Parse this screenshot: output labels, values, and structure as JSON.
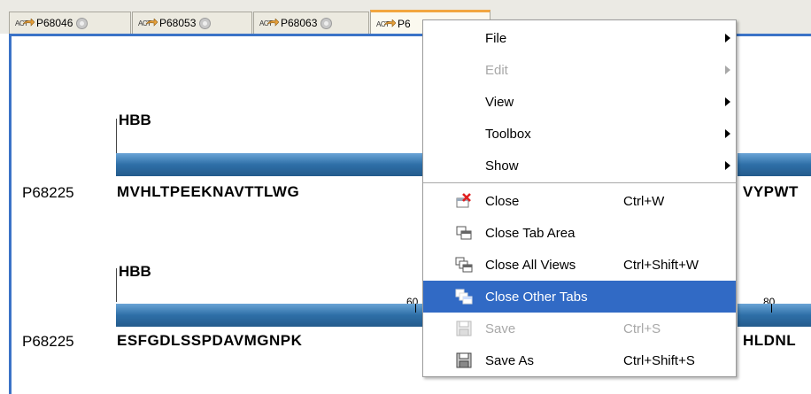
{
  "tabs": [
    {
      "label": "P68046",
      "badge": "ACT"
    },
    {
      "label": "P68053",
      "badge": "ACT"
    },
    {
      "label": "P68063",
      "badge": "ACT"
    },
    {
      "label": "P6",
      "badge": "ACT"
    }
  ],
  "rows": [
    {
      "gene": "HBB",
      "id": "P68225",
      "seq_left": "MVHLTPEEKNAVTTLWG",
      "seq_right": "VYPWT"
    },
    {
      "gene": "HBB",
      "id": "P68225",
      "seq_left": "ESFGDLSSPDAVMGNPK",
      "seq_right": "HLDNL",
      "ruler": [
        "60",
        "80"
      ]
    }
  ],
  "context_menu": {
    "items": [
      {
        "label": "File",
        "submenu": true
      },
      {
        "label": "Edit",
        "submenu": true,
        "disabled": true
      },
      {
        "label": "View",
        "submenu": true
      },
      {
        "label": "Toolbox",
        "submenu": true
      },
      {
        "label": "Show",
        "submenu": true
      },
      {
        "label": "Close",
        "shortcut": "Ctrl+W",
        "icon": "close-view-icon"
      },
      {
        "label": "Close Tab Area",
        "icon": "close-tab-area-icon"
      },
      {
        "label": "Close All Views",
        "shortcut": "Ctrl+Shift+W",
        "icon": "close-all-views-icon"
      },
      {
        "label": "Close Other Tabs",
        "icon": "close-other-tabs-icon",
        "highlighted": true
      },
      {
        "label": "Save",
        "shortcut": "Ctrl+S",
        "icon": "save-icon",
        "disabled": true
      },
      {
        "label": "Save As",
        "shortcut": "Ctrl+Shift+S",
        "icon": "save-as-icon"
      }
    ]
  },
  "colors": {
    "accent": "#316ac5",
    "bar": "#2e6fa7",
    "active_tab": "#f2a640"
  }
}
